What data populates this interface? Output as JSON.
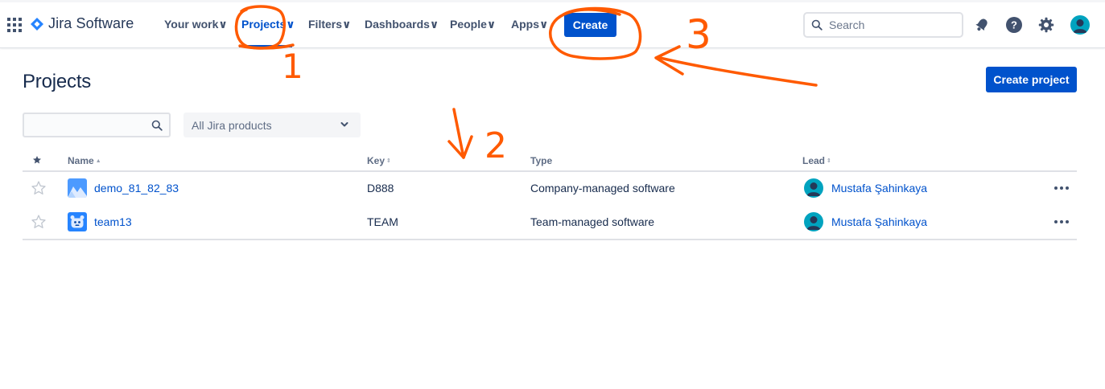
{
  "brand": {
    "name": "Jira Software"
  },
  "nav": {
    "your_work": "Your work",
    "projects": "Projects",
    "filters": "Filters",
    "dashboards": "Dashboards",
    "people": "People",
    "apps": "Apps",
    "create": "Create"
  },
  "search": {
    "placeholder": "Search"
  },
  "page": {
    "title": "Projects",
    "create_project": "Create project"
  },
  "filters": {
    "search_value": "",
    "product_select": "All Jira products"
  },
  "table": {
    "headers": {
      "name": "Name",
      "key": "Key",
      "type": "Type",
      "lead": "Lead"
    },
    "rows": [
      {
        "name": "demo_81_82_83",
        "key": "D888",
        "type": "Company-managed software",
        "lead": "Mustafa Şahinkaya",
        "icon": "mountain-project-icon"
      },
      {
        "name": "team13",
        "key": "TEAM",
        "type": "Team-managed software",
        "lead": "Mustafa Şahinkaya",
        "icon": "robot-project-icon"
      }
    ]
  },
  "annotations": {
    "one": "1",
    "two": "2",
    "three": "3"
  },
  "colors": {
    "primary": "#0052cc",
    "annotation": "#ff5a00",
    "text": "#172b4d"
  }
}
